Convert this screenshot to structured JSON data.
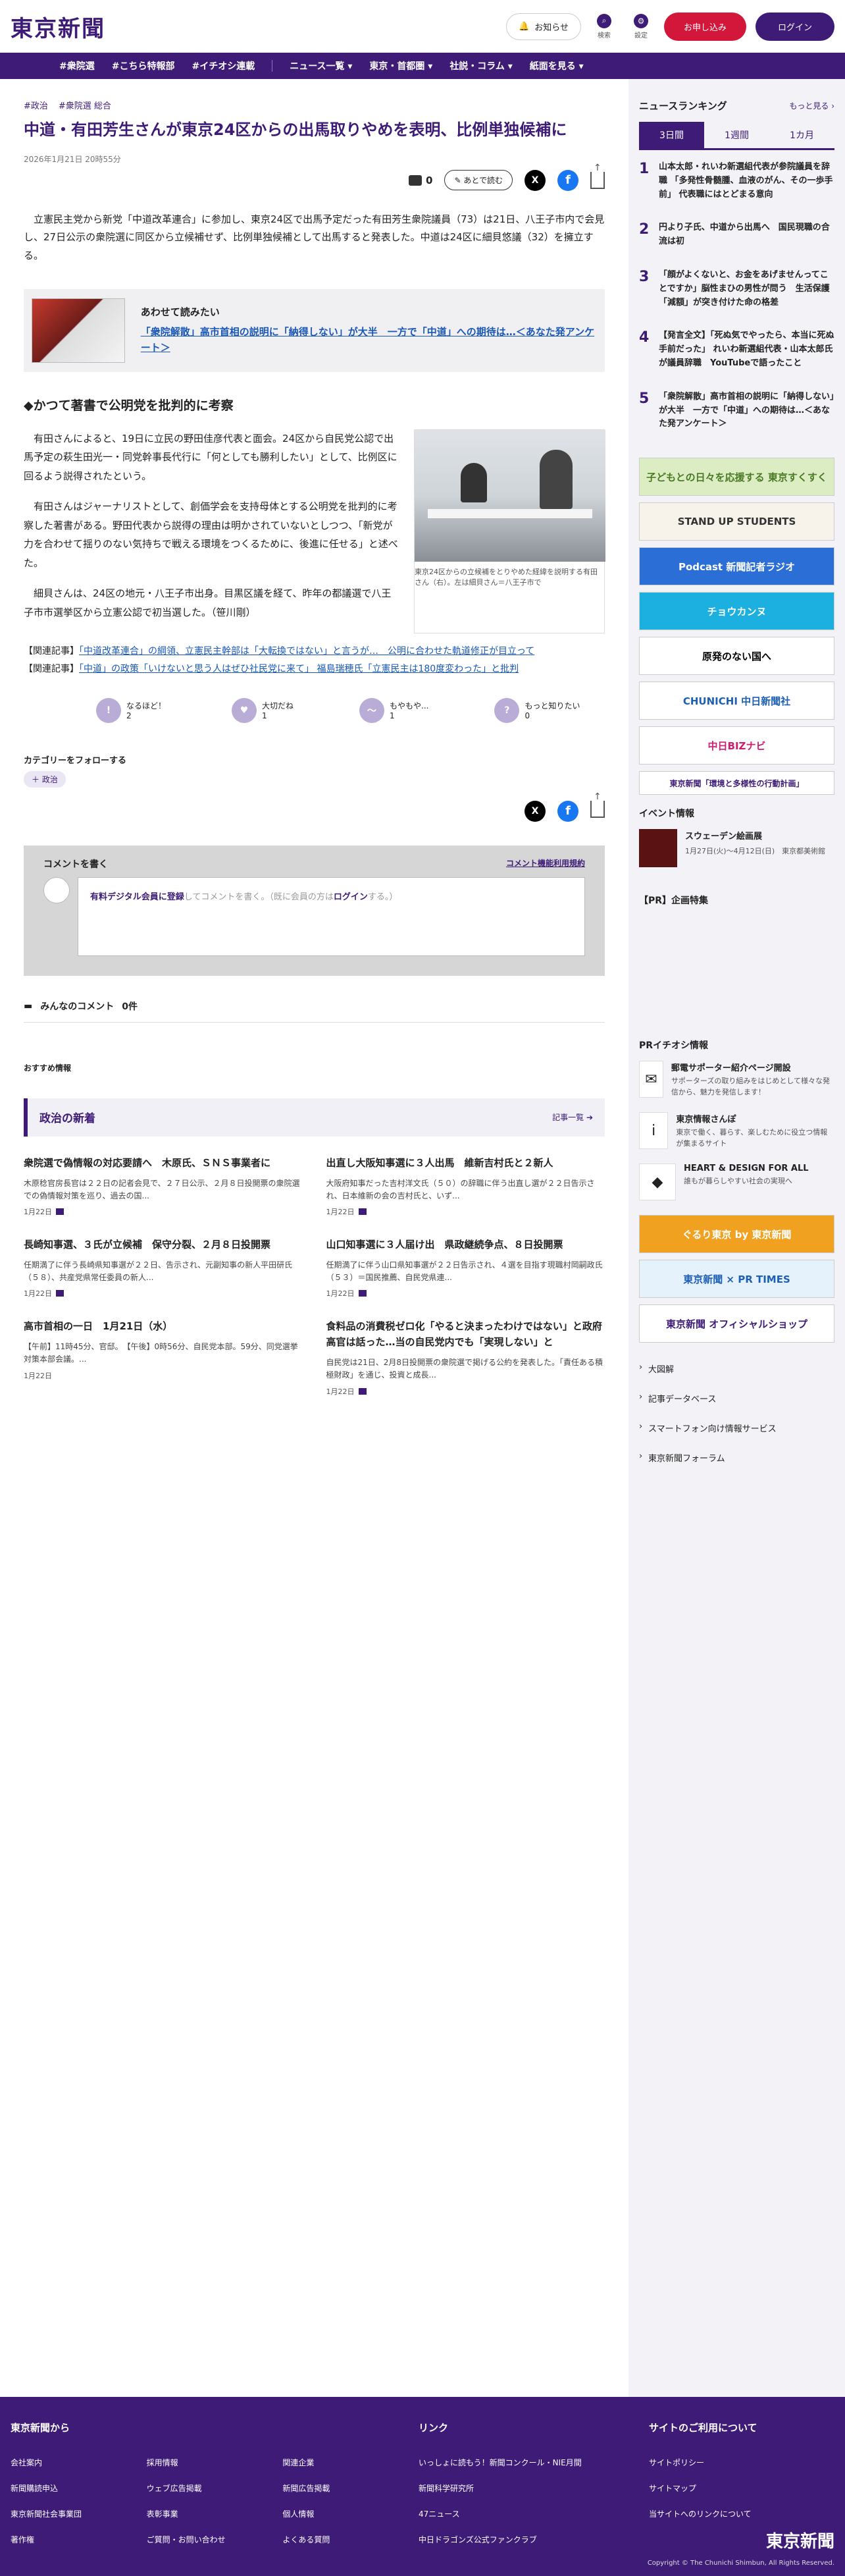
{
  "header": {
    "logo": "東京新聞",
    "notice": "お知らせ",
    "search": "検索",
    "settings": "設定",
    "apply": "お申し込み",
    "login": "ログイン"
  },
  "nav": [
    "#衆院選",
    "#こちら特報部",
    "#イチオシ連載",
    "ニュース一覧 ▾",
    "東京・首都圏 ▾",
    "社説・コラム ▾",
    "紙面を見る ▾"
  ],
  "article": {
    "tags": [
      "#政治",
      "#衆院選 総合"
    ],
    "title": "中道・有田芳生さんが東京24区からの出馬取りやめを表明、比例単独候補に",
    "date": "2026年1月21日 20時55分",
    "comment_count": "0",
    "read_later": "あとで読む",
    "lead": "立憲民主党から新党「中道改革連合」に参加し、東京24区で出馬予定だった有田芳生衆院議員（73）は21日、八王子市内で会見し、27日公示の衆院選に同区から立候補せず、比例単独候補として出馬すると発表した。中道は24区に細貝悠議（32）を擁立する。",
    "related_label": "あわせて読みたい",
    "related_link": "「衆院解散」高市首相の説明に「納得しない」が大半　一方で「中道」への期待は…＜あなた発アンケート＞",
    "heading": "◆かつて著書で公明党を批判的に考察",
    "paragraphs": [
      "有田さんによると、19日に立民の野田佳彦代表と面会。24区から自民党公認で出馬予定の萩生田光一・同党幹事長代行に「何としても勝利したい」として、比例区に回るよう説得されたという。",
      "有田さんはジャーナリストとして、創価学会を支持母体とする公明党を批判的に考察した著書がある。野田代表から説得の理由は明かされていないとしつつ、「新党が力を合わせて揺りのない気持ちで戦える環境をつくるために、後進に任せる」と述べた。",
      "細貝さんは、24区の地元・八王子市出身。目黒区議を経て、昨年の都議選で八王子市市選挙区から立憲公認で初当選した。（笹川剛）"
    ],
    "photo_caption": "東京24区からの立候補をとりやめた経緯を説明する有田さん（右）。左は細貝さん＝八王子市で",
    "kanren1_label": "【関連記事】",
    "kanren1_link": "「中道改革連合」の綱領、立憲民主幹部は「大転換ではない」と言うが…　公明に合わせた軌道修正が目立って",
    "kanren2_label": "【関連記事】",
    "kanren2_link": "「中道」の政策「いけないと思う人はぜひ社民党に来て」 福島瑞穂氏「立憲民主は180度変わった」と批判"
  },
  "reactions": [
    {
      "label": "なるほど！",
      "count": "2",
      "icon": "!"
    },
    {
      "label": "大切だね",
      "count": "1",
      "icon": "♥"
    },
    {
      "label": "もやもや...",
      "count": "1",
      "icon": "～"
    },
    {
      "label": "もっと知りたい",
      "count": "0",
      "icon": "?"
    }
  ],
  "follow": {
    "label": "カテゴリーをフォローする",
    "chip": "＋ 政治"
  },
  "comment_box": {
    "title": "コメントを書く",
    "rules": "コメント機能利用規約",
    "placeholder_pre": "有料デジタル会員に登録",
    "placeholder_mid": "してコメントを書く。（既に会員の方は",
    "placeholder_login": "ログイン",
    "placeholder_end": "する。）"
  },
  "all_comments": {
    "label": "みんなのコメント",
    "count": "0件"
  },
  "recommend": "おすすめ情報",
  "politics": {
    "title": "政治の新着",
    "more": "記事一覧",
    "items": [
      {
        "title": "衆院選で偽情報の対応要請へ　木原氏、ＳＮＳ事業者に",
        "excerpt": "木原稔官房長官は２２日の記者会見で、２７日公示、２月８日投開票の衆院選での偽情報対策を巡り、過去の国...",
        "date": "1月22日"
      },
      {
        "title": "出直し大阪知事選に３人出馬　維新吉村氏と２新人",
        "excerpt": "大阪府知事だった吉村洋文氏（５０）の辞職に伴う出直し選が２２日告示され、日本維新の会の吉村氏と、いず...",
        "date": "1月22日"
      },
      {
        "title": "長崎知事選、３氏が立候補　保守分裂、２月８日投開票",
        "excerpt": "任期満了に伴う長崎県知事選が２２日、告示され、元副知事の新人平田研氏（５８）、共産党県常任委員の新人...",
        "date": "1月22日"
      },
      {
        "title": "山口知事選に３人届け出　県政継続争点、８日投開票",
        "excerpt": "任期満了に伴う山口県知事選が２２日告示され、４選を目指す現職村岡嗣政氏（５３）＝国民推薦、自民党県連...",
        "date": "1月22日"
      },
      {
        "title": "高市首相の一日　1月21日（水）",
        "excerpt": "【午前】11時45分、官邸。　【午後】0時56分、自民党本部。59分、同党選挙対策本部会議。...",
        "date": "1月22日"
      },
      {
        "title": "食料品の消費税ゼロ化「やると決まったわけではない」と政府高官は話った…当の自民党内でも「実現しない」と",
        "excerpt": "自民党は21日、2月8日投開票の衆院選で掲げる公約を発表した。「責任ある積極財政」を通じ、投資と成長...",
        "date": "1月22日"
      }
    ]
  },
  "ranking": {
    "title": "ニュースランキング",
    "more": "もっと見る ›",
    "tabs": [
      "3日間",
      "1週間",
      "1カ月"
    ],
    "items": [
      {
        "n": "1",
        "title": "山本太郎・れいわ新選組代表が参院議員を辞職 「多発性骨髄腫、血液のがん、その一歩手前」 代表職にはとどまる意向"
      },
      {
        "n": "2",
        "title": "円より子氏、中道から出馬へ　国民現職の合流は初"
      },
      {
        "n": "3",
        "title": "「顔がよくないと、お金をあげませんってことですか」脳性まひの男性が問う　生活保護「減額」が突き付けた命の格差"
      },
      {
        "n": "4",
        "title": "【発言全文】「死ぬ気でやったら、本当に死ぬ手前だった」 れいわ新選組代表・山本太郎氏が議員辞職　YouTubeで語ったこと"
      },
      {
        "n": "5",
        "title": "「衆院解散」高市首相の説明に「納得しない」が大半　一方で「中道」への期待は…＜あなた発アンケート＞"
      }
    ]
  },
  "banners": [
    {
      "label": "子どもとの日々を応援する 東京すくすく",
      "bg": "#dcedc3",
      "fg": "#4a7a23"
    },
    {
      "label": "STAND UP STUDENTS",
      "bg": "#f7f2ea",
      "fg": "#333"
    },
    {
      "label": "Podcast 新聞記者ラジオ",
      "bg": "#2b6fd6",
      "fg": "#fff"
    },
    {
      "label": "チョウカンヌ",
      "bg": "#1bb0e0",
      "fg": "#fff"
    },
    {
      "label": "原発のない国へ",
      "bg": "#fff",
      "fg": "#000"
    },
    {
      "label": "CHUNICHI 中日新聞社",
      "bg": "#fff",
      "fg": "#1d5fb5"
    },
    {
      "label": "中日BIZナビ",
      "bg": "#fff",
      "fg": "#d01c6e"
    },
    {
      "label": "東京新聞「環境と多様性の行動計画」",
      "bg": "#fff",
      "fg": "#3d1b77"
    }
  ],
  "event": {
    "section": "イベント情報",
    "title": "スウェーデン絵画展",
    "sub": "1月27日(火)〜4月12日(日)　東京都美術館"
  },
  "pr_feature": "【PR】企画特集",
  "pr_osusume": {
    "section": "PRイチオシ情報",
    "items": [
      {
        "title": "郵電サポーター紹介ページ開設",
        "sub": "サポーターズの取り組みをはじめとして様々な発信から、魅力を発信します！",
        "icon": "✉"
      },
      {
        "title": "東京情報さんぽ",
        "sub": "東京で働く、暮らす、楽しむために役立つ情報が集まるサイト",
        "icon": "i"
      },
      {
        "title": "HEART & DESIGN FOR ALL",
        "sub": "誰もが暮らしやすい社会の実現へ",
        "icon": "◆"
      }
    ]
  },
  "banners2": [
    {
      "label": "ぐるり東京 by 東京新聞",
      "bg": "#f0a11f",
      "fg": "#fff"
    },
    {
      "label": "東京新聞 × PR TIMES",
      "bg": "#e6f2fb",
      "fg": "#1d5fb5"
    },
    {
      "label": "東京新聞 オフィシャルショップ",
      "bg": "#fff",
      "fg": "#3d1b77"
    }
  ],
  "side_links": [
    "大図解",
    "記事データベース",
    "スマートフォン向け情報サービス",
    "東京新聞フォーラム"
  ],
  "footer": {
    "col1_title": "東京新聞から",
    "col1": [
      "会社案内",
      "採用情報",
      "関連企業",
      "新聞購読申込",
      "ウェブ広告掲載",
      "新聞広告掲載",
      "東京新聞社会事業団",
      "表彰事業",
      "個人情報",
      "著作権",
      "ご質問・お問い合わせ",
      "よくある質問"
    ],
    "col2_title": "リンク",
    "col2": [
      "いっしょに読もう！新聞コンクール・NIE月間",
      "新聞科学研究所",
      "47ニュース",
      "中日ドラゴンズ公式ファンクラブ"
    ],
    "col3_title": "サイトのご利用について",
    "col3": [
      "サイトポリシー",
      "サイトマップ",
      "当サイトへのリンクについて"
    ],
    "logo": "東京新聞",
    "copyright": "Copyright © The Chunichi Shimbun, All Rights Reserved."
  }
}
